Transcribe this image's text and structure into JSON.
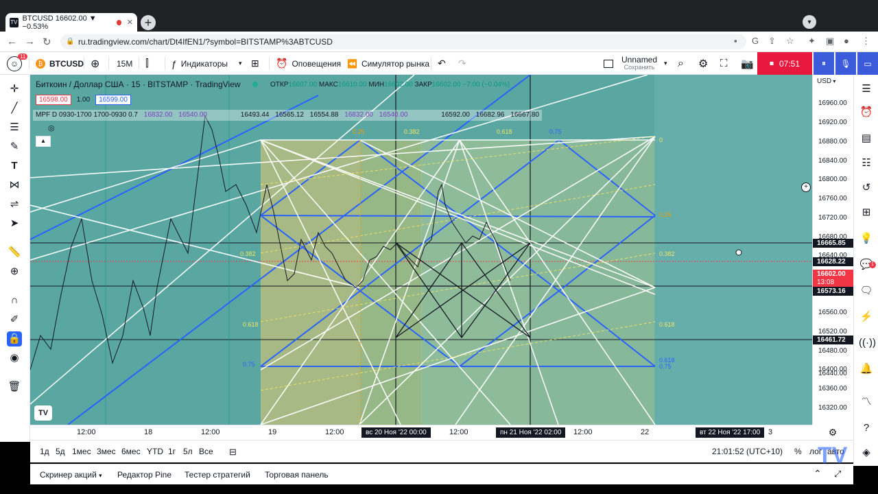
{
  "browser": {
    "tab_title": "BTCUSD 16602.00 ▼ −0.53%",
    "url": "ru.tradingview.com/chart/Dt4IfEN1/?symbol=BITSTAMP%3ABTCUSD"
  },
  "toolbar": {
    "avatar_badge": "11",
    "symbol": "BTCUSD",
    "interval": "15M",
    "indicators_label": "Индикаторы",
    "alerts_label": "Оповещения",
    "replay_label": "Симулятор рынка",
    "layout_name": "Unnamed",
    "layout_status": "Сохранить",
    "record_timer": "07:51"
  },
  "legend": {
    "title": "Биткоин / Доллар США · 15 · BITSTAMP · TradingView",
    "open_label": "ОТКР",
    "open": "16607.00",
    "high_label": "МАКС",
    "high": "16610.00",
    "low_label": "МИН",
    "low": "16602.00",
    "close_label": "ЗАКР",
    "close": "16602.00",
    "change": "−7.00 (−0.04%)",
    "bid": "16598.00",
    "quantity": "1.00",
    "ask": "16599.00"
  },
  "mpf": {
    "name": "MPF D 0930-1700 1700-0930 0.7",
    "values": [
      "16832.00",
      "16540.00",
      "16493.44",
      "16565.12",
      "16554.88",
      "16832.00",
      "16540.00",
      "16592.00",
      "16682.96",
      "16667.80"
    ]
  },
  "price_axis": {
    "currency": "USD",
    "ticks": [
      "16960.00",
      "16920.00",
      "16880.00",
      "16840.00",
      "16800.00",
      "16760.00",
      "16720.00",
      "16680.00",
      "16640.00",
      "16560.00",
      "16520.00",
      "16480.00",
      "16440.00",
      "16400.00",
      "16360.00",
      "16320.00"
    ],
    "labels": [
      {
        "value": "16665.85",
        "color": "#131722"
      },
      {
        "value": "16628.22",
        "color": "#131722"
      },
      {
        "value": "16602.00",
        "color": "#f23645"
      },
      {
        "value": "13:08",
        "color": "#f23645"
      },
      {
        "value": "16573.16",
        "color": "#131722"
      },
      {
        "value": "16461.72",
        "color": "#131722"
      }
    ]
  },
  "time_axis": {
    "ticks": [
      "12:00",
      "18",
      "12:00",
      "19",
      "12:00",
      "12:00",
      "12:00",
      "22",
      "3"
    ],
    "labels": [
      "вс 20 Ноя '22   00:00",
      "пн 21 Ноя '22   02:00",
      "вт 22 Ноя '22   17:00"
    ]
  },
  "fib_labels": [
    "0.25",
    "0.382",
    "0.618",
    "0.75",
    "0",
    "0.25",
    "0.382",
    "0.618",
    "0.618",
    "0.75",
    "0.382",
    "0.618",
    "0.75"
  ],
  "bottom": {
    "ranges": [
      "1д",
      "5д",
      "1мес",
      "3мес",
      "6мес",
      "YTD",
      "1г",
      "5л",
      "Все"
    ],
    "clock": "21:01:52 (UTC+10)",
    "percent": "%",
    "log": "лог",
    "auto": "авто"
  },
  "panels": [
    "Скринер акций",
    "Редактор Pine",
    "Тестер стратегий",
    "Торговая панель"
  ],
  "colors": {
    "chart_bg": "#5aa7a1",
    "accent_blue": "#2962ff",
    "down_red": "#f23645",
    "up_green": "#089981"
  }
}
